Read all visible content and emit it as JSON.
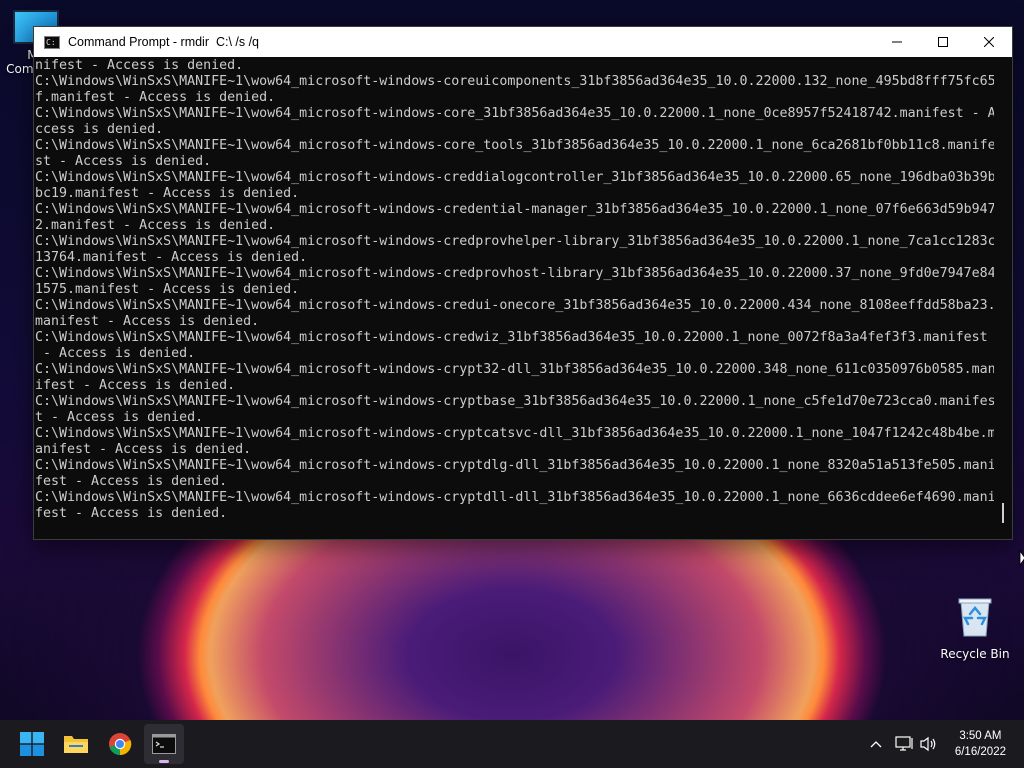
{
  "desktop": {
    "icons": [
      {
        "label": "My Computer",
        "icon": "monitor-icon"
      },
      {
        "label": "Recycle Bin",
        "icon": "recycle-bin-icon"
      }
    ]
  },
  "window": {
    "title": "Command Prompt - rmdir  C:\\ /s /q",
    "icon": "console-icon",
    "controls": {
      "minimize": "minimize-icon",
      "maximize": "maximize-icon",
      "close": "close-icon"
    }
  },
  "console": {
    "lines": [
      "C:\\Windows\\WinSxS\\MANIFE~1\\wow64_microsoft-windows-coreuicomponents_31bf3856ad364e35_10.0.22000.132_none_495bd8fff75fc65",
      "f.manifest - Access is denied.",
      "C:\\Windows\\WinSxS\\MANIFE~1\\wow64_microsoft-windows-core_31bf3856ad364e35_10.0.22000.1_none_0ce8957f52418742.manifest - A",
      "ccess is denied.",
      "C:\\Windows\\WinSxS\\MANIFE~1\\wow64_microsoft-windows-core_tools_31bf3856ad364e35_10.0.22000.1_none_6ca2681bf0bb11c8.manife",
      "st - Access is denied.",
      "C:\\Windows\\WinSxS\\MANIFE~1\\wow64_microsoft-windows-creddialogcontroller_31bf3856ad364e35_10.0.22000.65_none_196dba03b39b",
      "bc19.manifest - Access is denied.",
      "C:\\Windows\\WinSxS\\MANIFE~1\\wow64_microsoft-windows-credential-manager_31bf3856ad364e35_10.0.22000.1_none_07f6e663d59b947",
      "2.manifest - Access is denied.",
      "C:\\Windows\\WinSxS\\MANIFE~1\\wow64_microsoft-windows-credprovhelper-library_31bf3856ad364e35_10.0.22000.1_none_7ca1cc1283c",
      "13764.manifest - Access is denied.",
      "C:\\Windows\\WinSxS\\MANIFE~1\\wow64_microsoft-windows-credprovhost-library_31bf3856ad364e35_10.0.22000.37_none_9fd0e7947e84",
      "1575.manifest - Access is denied.",
      "C:\\Windows\\WinSxS\\MANIFE~1\\wow64_microsoft-windows-credui-onecore_31bf3856ad364e35_10.0.22000.434_none_8108eeffdd58ba23.",
      "manifest - Access is denied.",
      "C:\\Windows\\WinSxS\\MANIFE~1\\wow64_microsoft-windows-credwiz_31bf3856ad364e35_10.0.22000.1_none_0072f8a3a4fef3f3.manifest",
      " - Access is denied.",
      "C:\\Windows\\WinSxS\\MANIFE~1\\wow64_microsoft-windows-crypt32-dll_31bf3856ad364e35_10.0.22000.348_none_611c0350976b0585.man",
      "ifest - Access is denied.",
      "C:\\Windows\\WinSxS\\MANIFE~1\\wow64_microsoft-windows-cryptbase_31bf3856ad364e35_10.0.22000.1_none_c5fe1d70e723cca0.manifes",
      "t - Access is denied.",
      "C:\\Windows\\WinSxS\\MANIFE~1\\wow64_microsoft-windows-cryptcatsvc-dll_31bf3856ad364e35_10.0.22000.1_none_1047f1242c48b4be.m",
      "anifest - Access is denied.",
      "C:\\Windows\\WinSxS\\MANIFE~1\\wow64_microsoft-windows-cryptdlg-dll_31bf3856ad364e35_10.0.22000.1_none_8320a51a513fe505.mani",
      "fest - Access is denied.",
      "C:\\Windows\\WinSxS\\MANIFE~1\\wow64_microsoft-windows-cryptdll-dll_31bf3856ad364e35_10.0.22000.1_none_6636cddee6ef4690.mani",
      "fest - Access is denied."
    ],
    "first_line_partial": "nifest - Access is denied."
  },
  "taskbar": {
    "apps": [
      {
        "name": "start-button",
        "icon": "windows-start-icon"
      },
      {
        "name": "file-explorer-button",
        "icon": "folder-icon"
      },
      {
        "name": "chrome-button",
        "icon": "chrome-icon"
      },
      {
        "name": "command-prompt-button",
        "icon": "console-icon",
        "active": true
      }
    ],
    "tray": {
      "icons": [
        "chevron-up-icon",
        "network-icon",
        "volume-icon"
      ]
    },
    "clock": {
      "time": "3:50 AM",
      "date": "6/16/2022"
    }
  },
  "colors": {
    "console_bg": "#0c0c0c",
    "console_fg": "#cccccc",
    "taskbar_bg": "#1b1b1f",
    "accent_indicator": "#d8b4f0"
  }
}
